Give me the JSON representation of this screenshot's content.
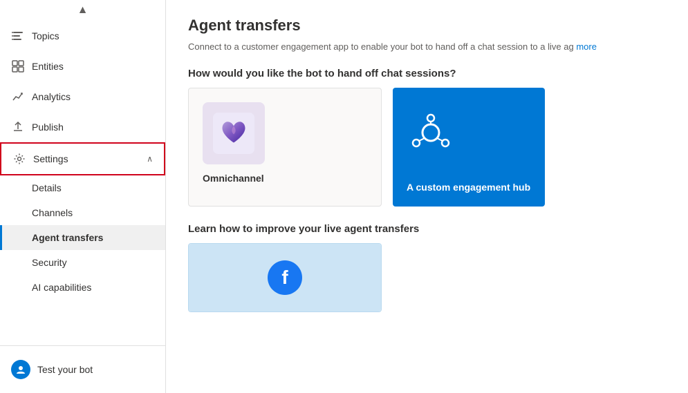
{
  "sidebar": {
    "scroll_up_icon": "▲",
    "items": [
      {
        "id": "topics",
        "label": "Topics",
        "icon": "topics"
      },
      {
        "id": "entities",
        "label": "Entities",
        "icon": "entities"
      },
      {
        "id": "analytics",
        "label": "Analytics",
        "icon": "analytics"
      },
      {
        "id": "publish",
        "label": "Publish",
        "icon": "publish"
      },
      {
        "id": "settings",
        "label": "Settings",
        "icon": "settings",
        "expanded": true,
        "active": true
      }
    ],
    "sub_items": [
      {
        "id": "details",
        "label": "Details"
      },
      {
        "id": "channels",
        "label": "Channels"
      },
      {
        "id": "agent-transfers",
        "label": "Agent transfers",
        "active": true
      },
      {
        "id": "security",
        "label": "Security"
      },
      {
        "id": "ai-capabilities",
        "label": "AI capabilities"
      }
    ],
    "test_bot": {
      "label": "Test your bot",
      "icon": "bot"
    }
  },
  "main": {
    "title": "Agent transfers",
    "description": "Connect to a customer engagement app to enable your bot to hand off a chat session to a live ag",
    "more_link": "more",
    "handoff_question": "How would you like the bot to hand off chat sessions?",
    "cards": [
      {
        "id": "omnichannel",
        "label": "Omnichannel"
      },
      {
        "id": "custom-hub",
        "label": "A custom engagement hub"
      }
    ],
    "learn_title": "Learn how to improve your live agent transfers",
    "learn_cards": [
      {
        "id": "facebook",
        "label": ""
      }
    ]
  }
}
